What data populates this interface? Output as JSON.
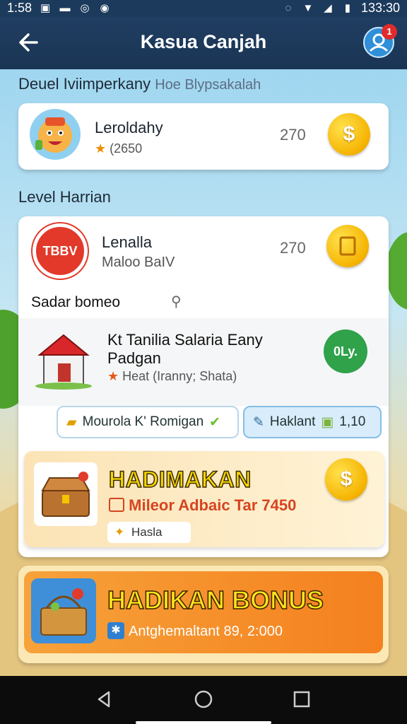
{
  "status_bar": {
    "time": "1:58",
    "clock_right": "133:30"
  },
  "header": {
    "title": "Kasua Canjah",
    "notification_count": "1"
  },
  "section1": {
    "title": "Deuel Iviimperkany",
    "subtitle": "Hoe Blypsakalah"
  },
  "card1": {
    "name": "Leroldahy",
    "stars": "(2650",
    "score": "270",
    "coin_symbol": "$"
  },
  "section2": {
    "title": "Level Harrian"
  },
  "card2": {
    "logo_text": "TBBV",
    "name": "Lenalla",
    "meta": "Maloo BaIV",
    "score": "270",
    "row_title": "Sadar bomeo",
    "item_title_1": "Kt Tanilia Salaria Eany",
    "item_title_2": "Padgan",
    "item_meta": "Heat (Iranny; Shata)",
    "badge": "0Ly.",
    "btn_left": "Mourola K' Romigan",
    "btn_right": "Haklant",
    "btn_right_value": "1,10"
  },
  "reward": {
    "title": "HADIMAKAN",
    "subtitle": "Mileor Adbaic Tar 7450",
    "chip": "Hasla",
    "coin_symbol": "$"
  },
  "bonus": {
    "title": "HADIKAN BONUS",
    "subtitle": "Antghemaltant 89, 2:000"
  },
  "colors": {
    "appbar": "#1f3d60",
    "coin": "#f5b300",
    "badge_green": "#2fa24a",
    "bonus_orange": "#f4801e"
  }
}
